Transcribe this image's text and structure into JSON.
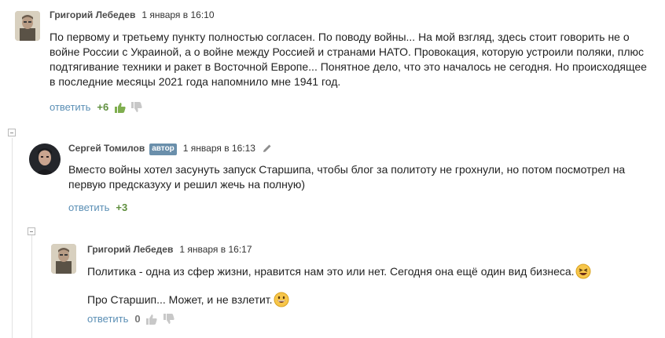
{
  "comments": [
    {
      "author": "Григорий Лебедев",
      "date": "1 января в 16:10",
      "text": "По первому и третьему пункту полностью согласен. По поводу войны... На мой взгляд, здесь стоит говорить не о войне России с Украиной, а о войне между Россией и странами НАТО. Провокация, которую устроили поляки, плюс подтягивание техники и ракет в Восточной Европе... Понятное дело, что это началось не сегодня. Но происходящее в последние месяцы 2021 года напомнило мне 1941 год.",
      "reply_label": "ответить",
      "score": "+6"
    },
    {
      "author": "Сергей Томилов",
      "badge": "автор",
      "date": "1 января в 16:13",
      "text": "Вместо войны хотел засунуть запуск Старшипа, чтобы блог за политоту не грохнули, но потом посмотрел на первую предсказуху и решил жечь на полную)",
      "reply_label": "ответить",
      "score": "+3"
    },
    {
      "author": "Григорий Лебедев",
      "date": "1 января в 16:17",
      "paragraph1": "Политика - одна из сфер жизни, нравится нам это или нет. Сегодня она ещё один вид бизнеса.",
      "paragraph2": "Про Старшип... Может, и не взлетит.",
      "reply_label": "ответить",
      "score": "0"
    }
  ],
  "icons": {
    "thumb_up": "thumbs-up-icon",
    "thumb_down": "thumbs-down-icon",
    "edit": "pencil-icon",
    "collapse": "collapse-minus-icon",
    "emoji_laugh": "laughing-emoji",
    "emoji_grin": "grinning-emoji"
  },
  "colors": {
    "reply_link": "#5b8fb5",
    "positive_score": "#5f8f3e",
    "author_badge": "#6a8fab",
    "thumb_up_active": "#7fae4f",
    "thumb_inactive": "#c8c8c8"
  }
}
